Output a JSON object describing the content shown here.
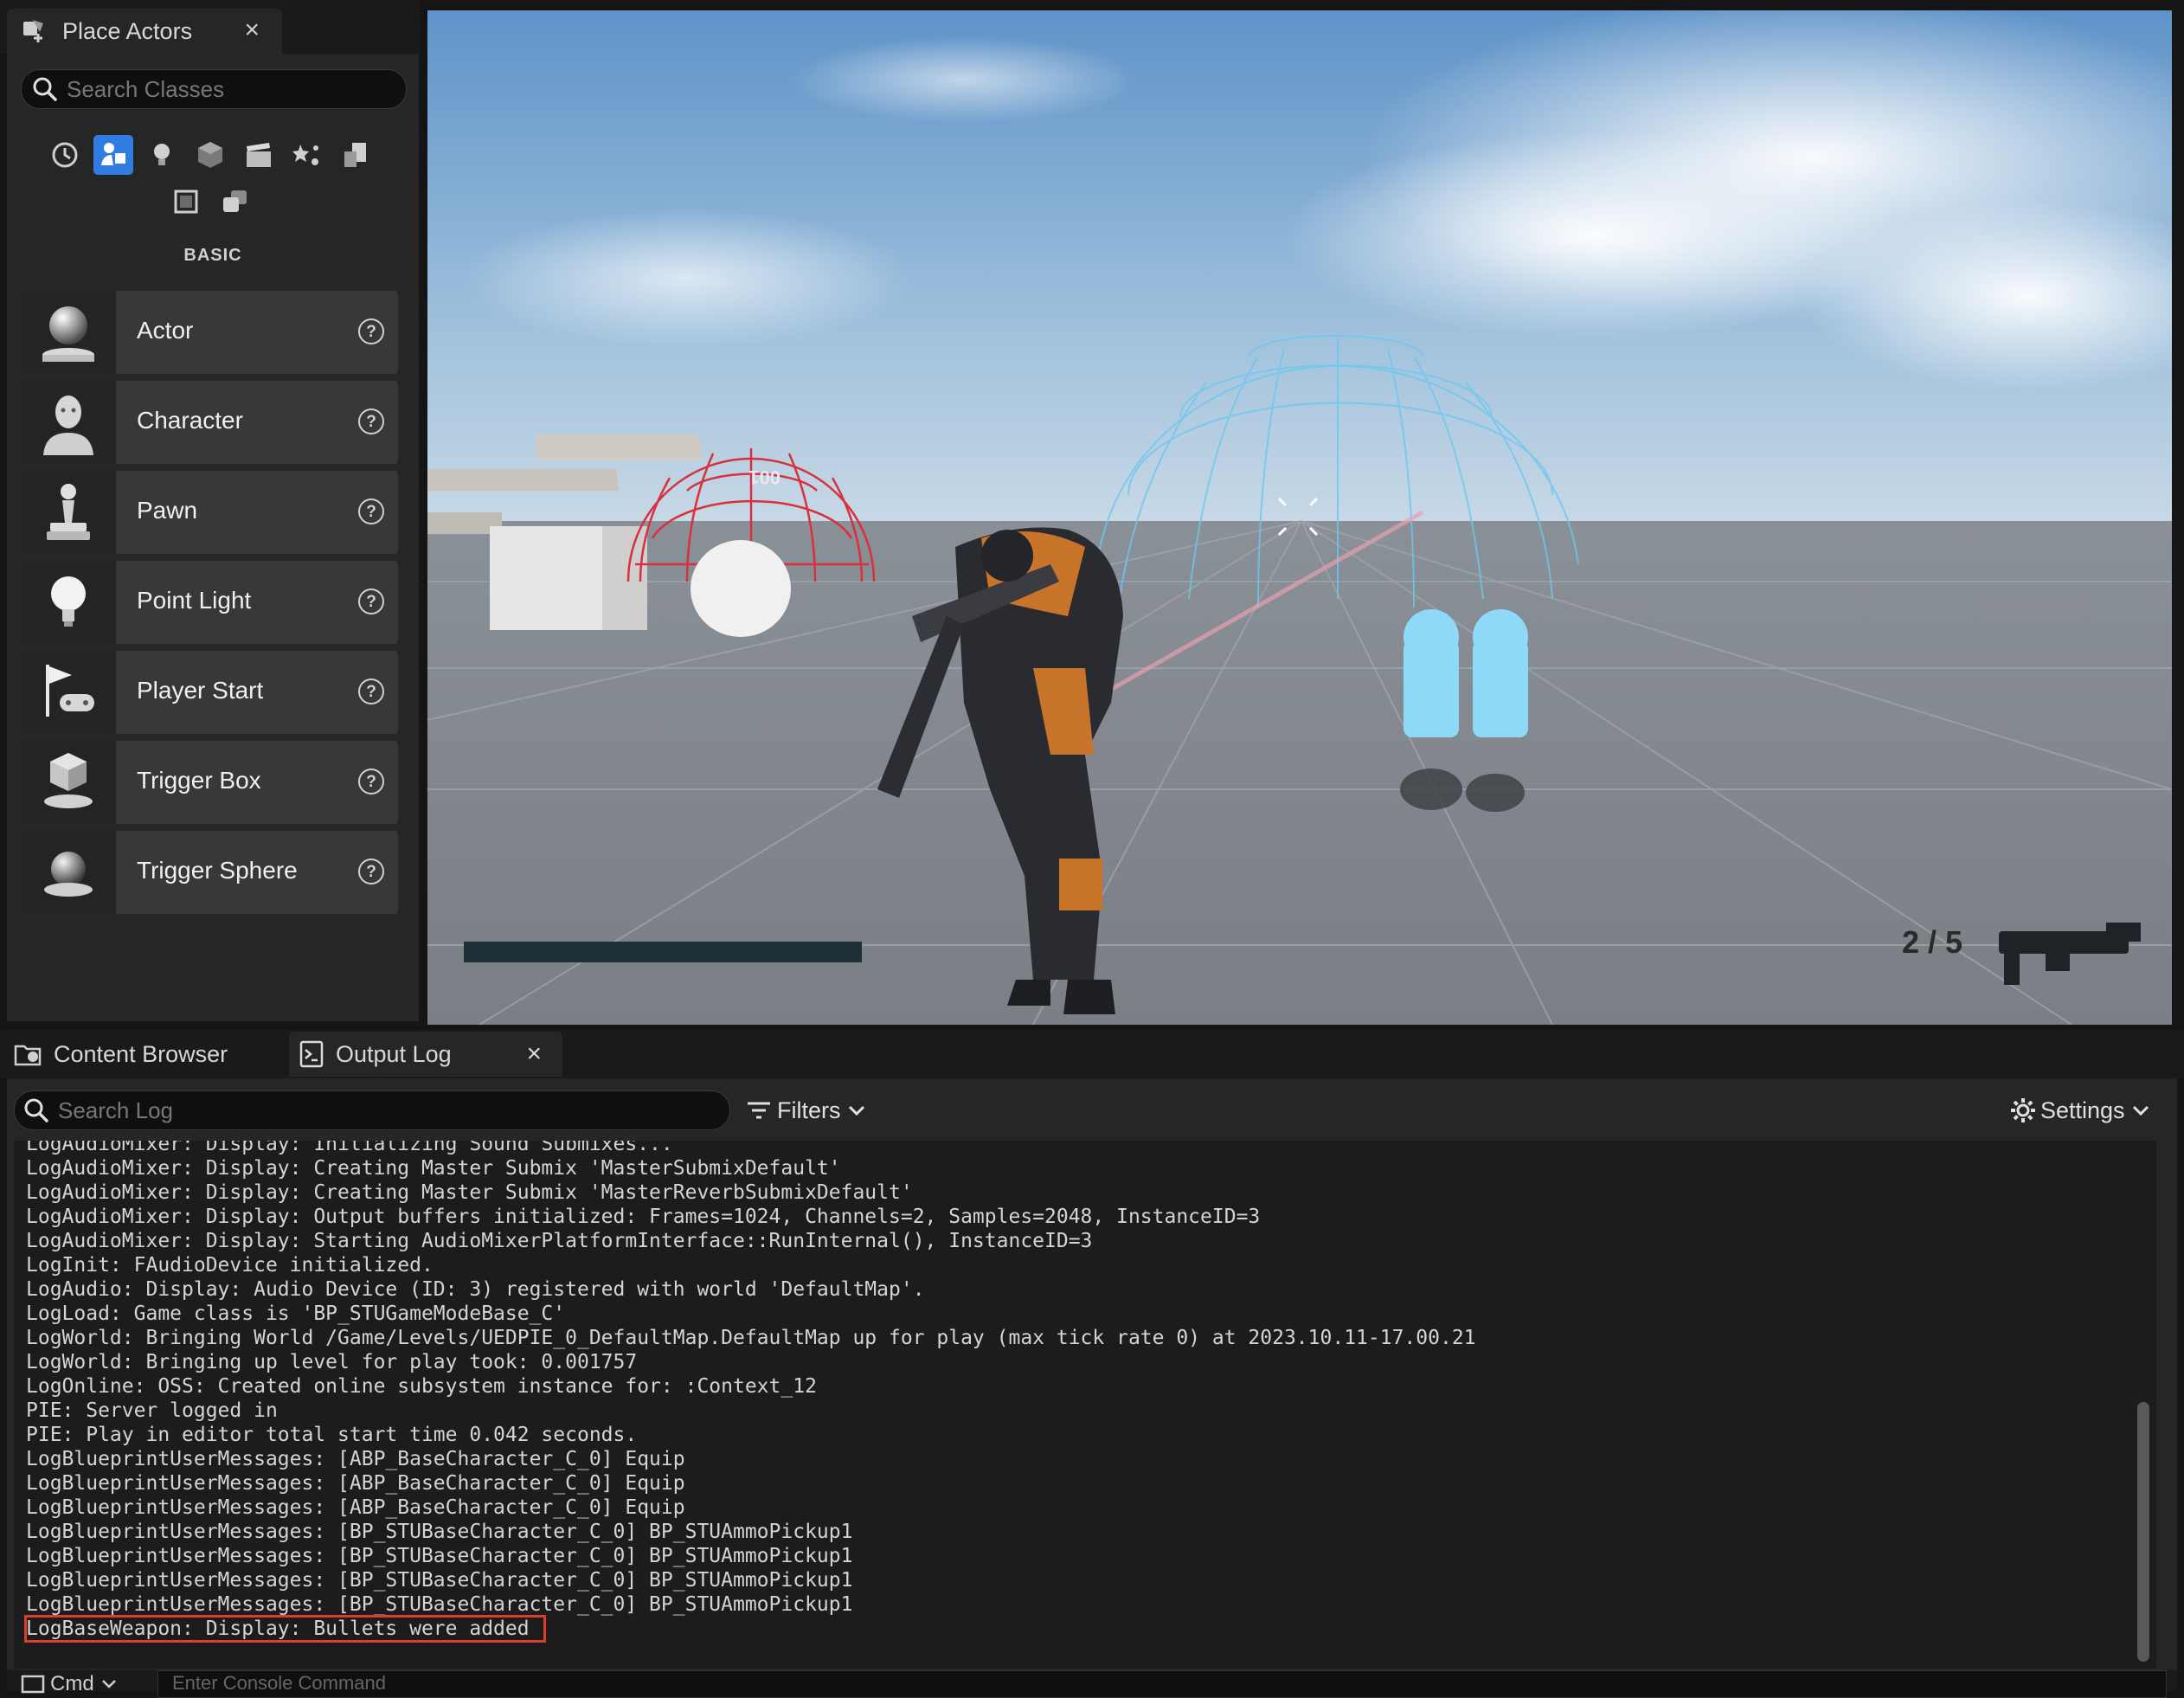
{
  "place_actors": {
    "tab_title": "Place Actors",
    "close_label": "×",
    "search_placeholder": "Search Classes",
    "categories": [
      "recent-icon",
      "basic-icon",
      "lights-icon",
      "shapes-icon",
      "cinematic-icon",
      "visual-effects-icon",
      "geometry-icon",
      "volumes-icon",
      "all-classes-icon"
    ],
    "active_category": "basic-icon",
    "section_label": "BASIC",
    "items": [
      {
        "label": "Actor",
        "icon": "actor-sphere-icon"
      },
      {
        "label": "Character",
        "icon": "character-icon"
      },
      {
        "label": "Pawn",
        "icon": "pawn-icon"
      },
      {
        "label": "Point Light",
        "icon": "light-bulb-icon"
      },
      {
        "label": "Player Start",
        "icon": "player-start-flag-icon"
      },
      {
        "label": "Trigger Box",
        "icon": "trigger-box-icon"
      },
      {
        "label": "Trigger Sphere",
        "icon": "trigger-sphere-icon"
      }
    ]
  },
  "viewport": {
    "hud_ammo": "2 / 5",
    "sphere_label": "001"
  },
  "bottom_tabs": {
    "content_browser": "Content Browser",
    "output_log": "Output Log",
    "close_label": "×"
  },
  "output_log": {
    "search_placeholder": "Search Log",
    "filters_label": "Filters",
    "settings_label": "Settings",
    "lines": [
      "LogAudioMixer: Display: Initializing Sound Submixes...",
      "LogAudioMixer: Display: Creating Master Submix 'MasterSubmixDefault'",
      "LogAudioMixer: Display: Creating Master Submix 'MasterReverbSubmixDefault'",
      "LogAudioMixer: Display: Output buffers initialized: Frames=1024, Channels=2, Samples=2048, InstanceID=3",
      "LogAudioMixer: Display: Starting AudioMixerPlatformInterface::RunInternal(), InstanceID=3",
      "LogInit: FAudioDevice initialized.",
      "LogAudio: Display: Audio Device (ID: 3) registered with world 'DefaultMap'.",
      "LogLoad: Game class is 'BP_STUGameModeBase_C'",
      "LogWorld: Bringing World /Game/Levels/UEDPIE_0_DefaultMap.DefaultMap up for play (max tick rate 0) at 2023.10.11-17.00.21",
      "LogWorld: Bringing up level for play took: 0.001757",
      "LogOnline: OSS: Created online subsystem instance for: :Context_12",
      "PIE: Server logged in",
      "PIE: Play in editor total start time 0.042 seconds.",
      "LogBlueprintUserMessages: [ABP_BaseCharacter_C_0] Equip",
      "LogBlueprintUserMessages: [ABP_BaseCharacter_C_0] Equip",
      "LogBlueprintUserMessages: [ABP_BaseCharacter_C_0] Equip",
      "LogBlueprintUserMessages: [BP_STUBaseCharacter_C_0] BP_STUAmmoPickup1",
      "LogBlueprintUserMessages: [BP_STUBaseCharacter_C_0] BP_STUAmmoPickup1",
      "LogBlueprintUserMessages: [BP_STUBaseCharacter_C_0] BP_STUAmmoPickup1",
      "LogBlueprintUserMessages: [BP_STUBaseCharacter_C_0] BP_STUAmmoPickup1",
      "LogBaseWeapon: Display: Bullets were added"
    ],
    "highlighted_line_index": 20,
    "highlight_color": "#d8402a"
  },
  "console": {
    "cmd_label": "Cmd",
    "placeholder": "Enter Console Command"
  },
  "colors": {
    "accent": "#2f7de1",
    "panel_bg": "#262626",
    "log_bg": "#1c1c1c"
  }
}
